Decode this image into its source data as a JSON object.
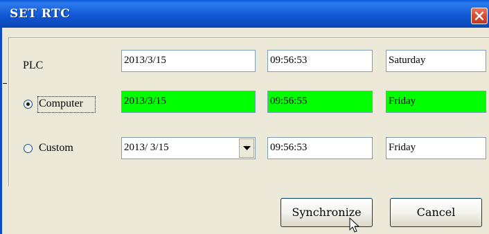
{
  "window": {
    "title": "SET RTC"
  },
  "rows": {
    "plc": {
      "label": "PLC",
      "date": "2013/3/15",
      "time": "09:56:53",
      "weekday": "Saturday"
    },
    "computer": {
      "label": "Computer",
      "selected": true,
      "date": "2013/3/15",
      "time": "09:56:55",
      "weekday": "Friday",
      "highlight_color": "#00ff00"
    },
    "custom": {
      "label": "Custom",
      "selected": false,
      "date": "2013/ 3/15",
      "time": "09:56:53",
      "weekday": "Friday"
    }
  },
  "buttons": {
    "synchronize": "Synchronize",
    "cancel": "Cancel"
  },
  "colors": {
    "titlebar": "#0a5bd8",
    "dialog_bg": "#ece9d8",
    "close_button": "#d3482a"
  },
  "icons": [
    "close-icon",
    "chevron-down-icon",
    "mouse-cursor-icon"
  ]
}
